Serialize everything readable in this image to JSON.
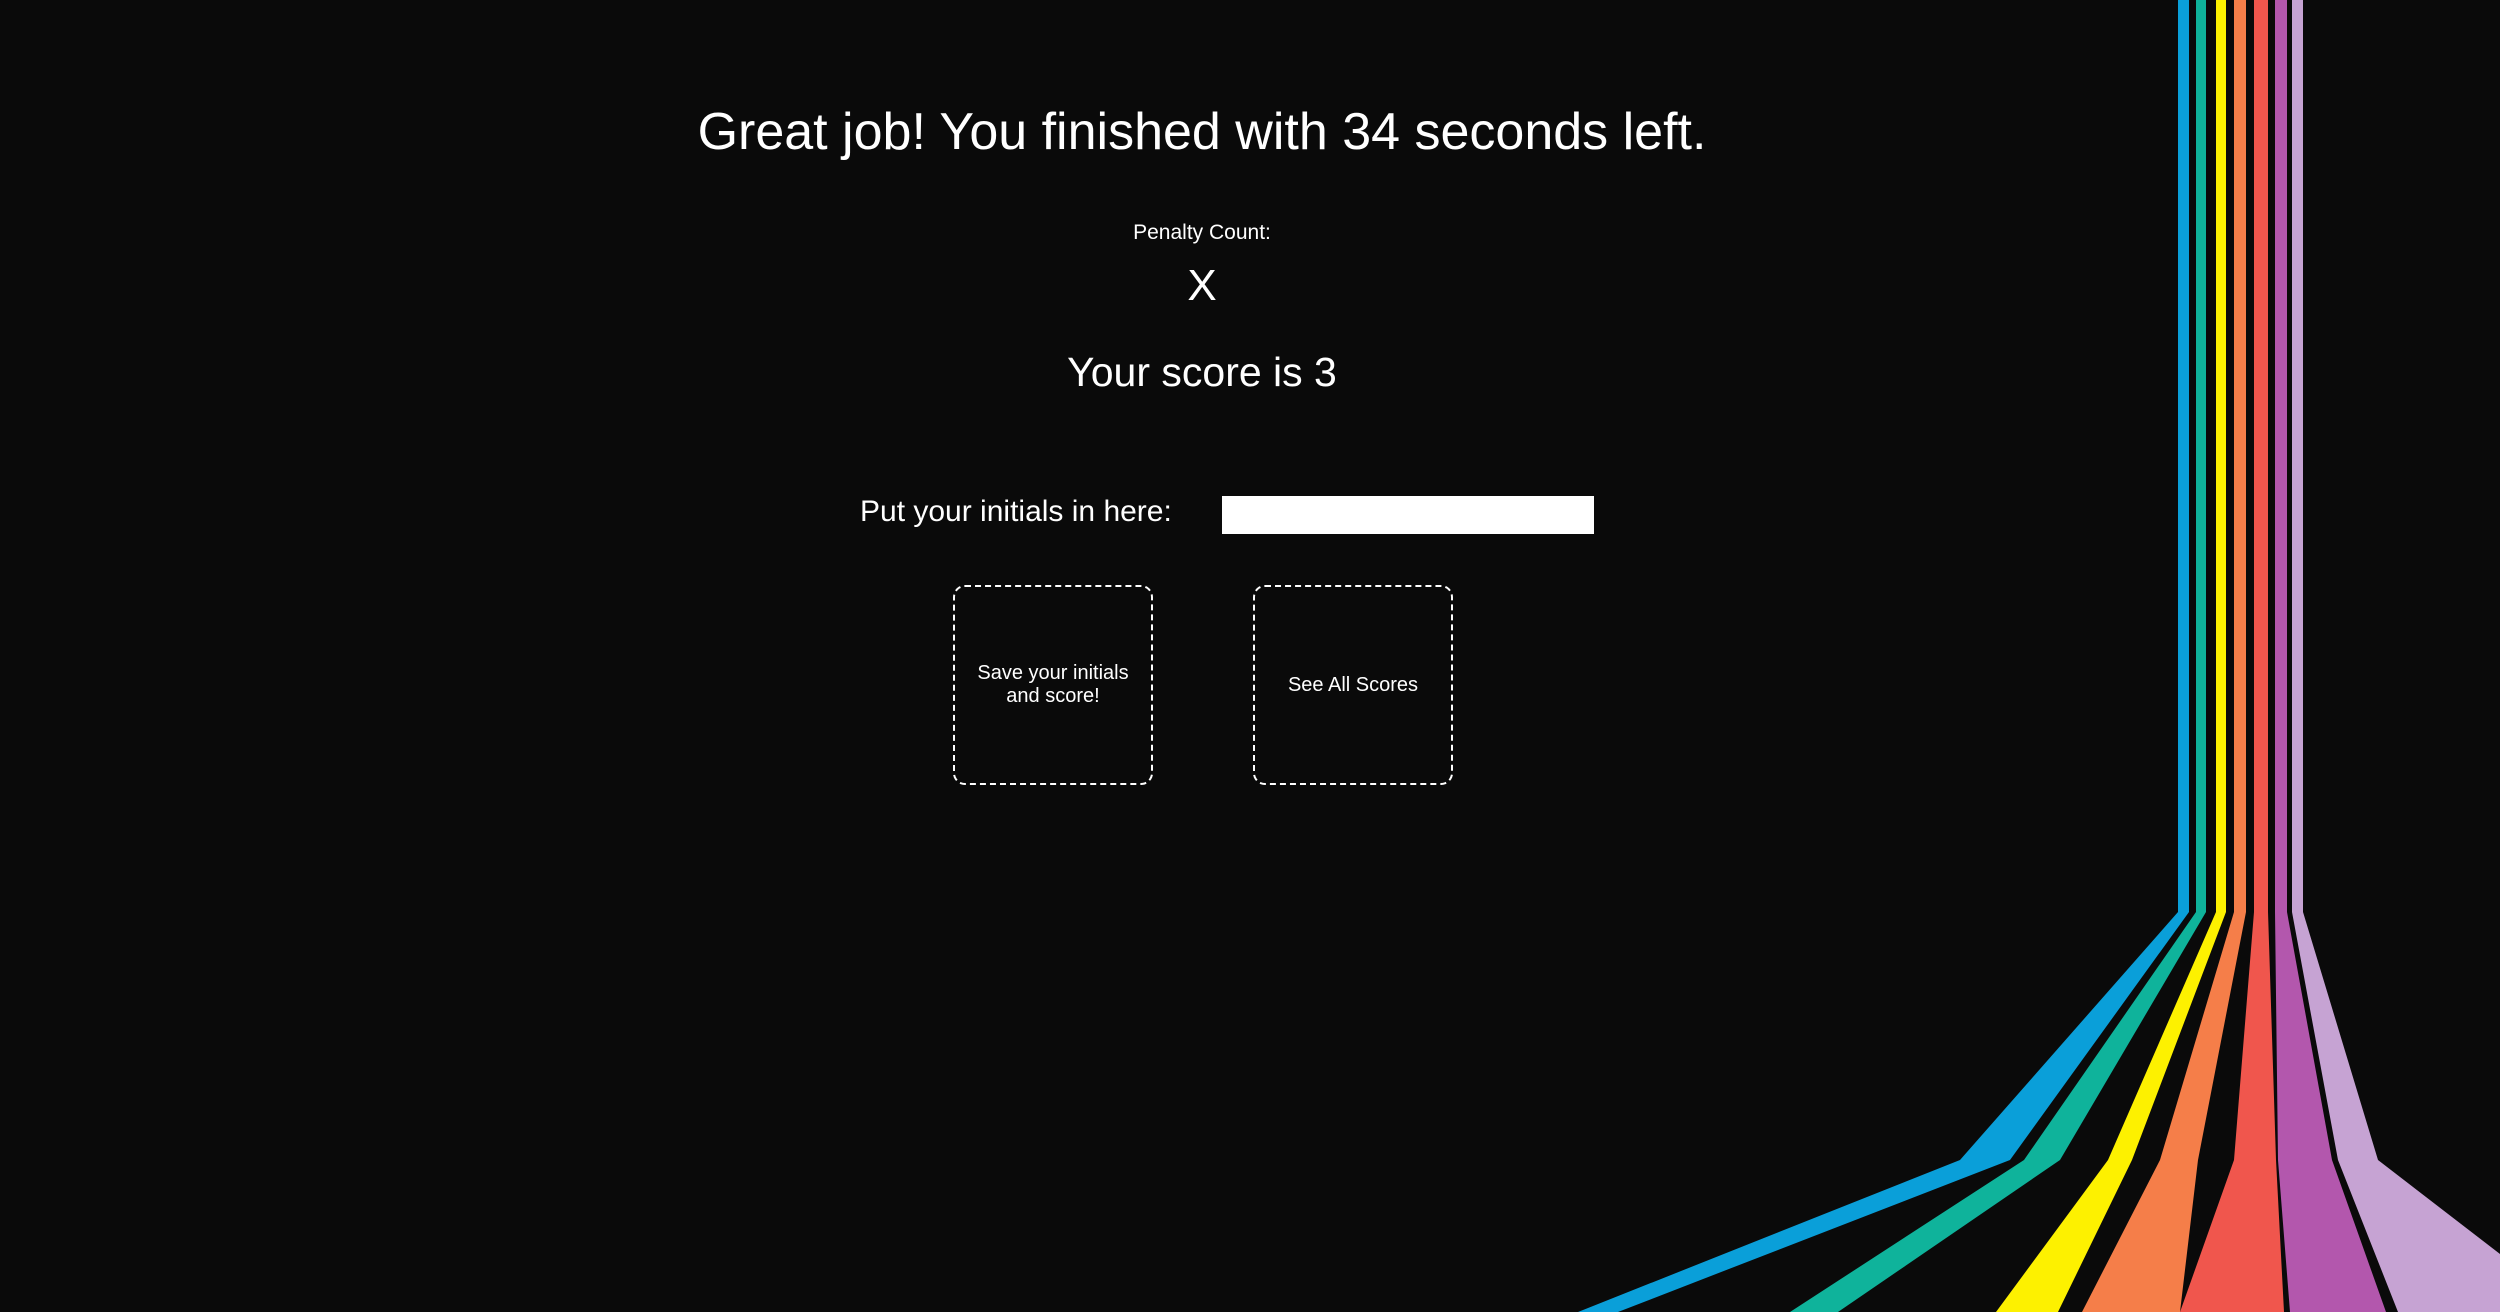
{
  "result": {
    "title": "Great job! You finished with 34 seconds left.",
    "penalty_label": "Penalty Count:",
    "penalty_marks": "X",
    "score_text": "Your score is 3"
  },
  "form": {
    "initials_label": "Put your initials in here:",
    "initials_value": "",
    "initials_placeholder": ""
  },
  "buttons": {
    "save_label": "Save your initials and score!",
    "see_scores_label": "See All Scores"
  },
  "colors": {
    "background": "#0a0a0a",
    "text": "#ffffff",
    "stripe_blue": "#0a9fd9",
    "stripe_teal": "#0fb39b",
    "stripe_yellow": "#fdf100",
    "stripe_orange": "#f57e49",
    "stripe_red": "#f0564d",
    "stripe_purple": "#b357ad",
    "stripe_lavender": "#c6a3d3"
  }
}
